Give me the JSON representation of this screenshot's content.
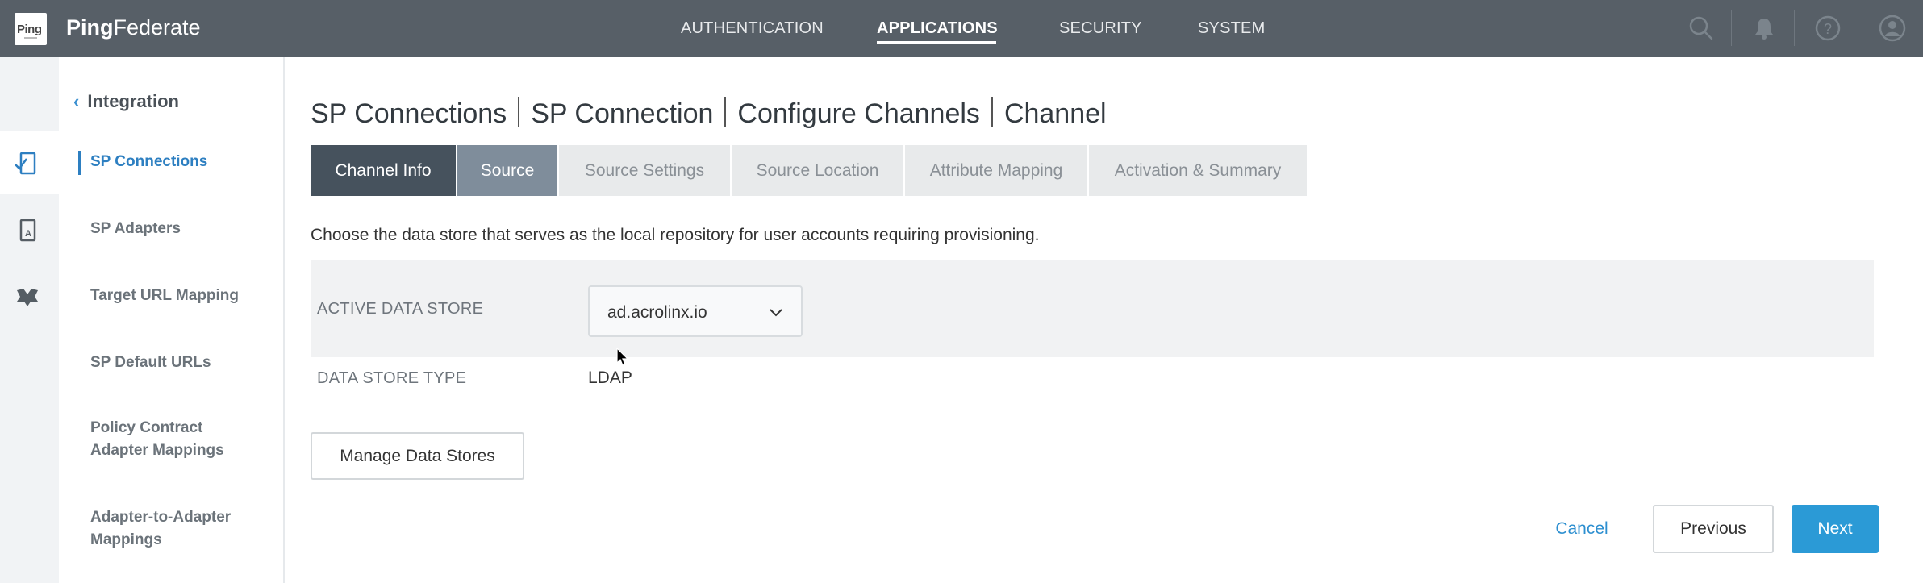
{
  "header": {
    "logo_text": "Ping",
    "brand_bold": "Ping",
    "brand_light": "Federate",
    "nav": [
      {
        "label": "AUTHENTICATION"
      },
      {
        "label": "APPLICATIONS",
        "active": true
      },
      {
        "label": "SECURITY"
      },
      {
        "label": "SYSTEM"
      }
    ],
    "icons": [
      "search-icon",
      "bell-icon",
      "help-icon",
      "user-icon"
    ]
  },
  "rail": {
    "icons": [
      "sp-connection-icon",
      "sp-adapter-icon",
      "federation-icon"
    ]
  },
  "sidebar": {
    "back_label": "Integration",
    "items": [
      {
        "label": "SP Connections",
        "active": true
      },
      {
        "label": "SP Adapters"
      },
      {
        "label": "Target URL Mapping"
      },
      {
        "label": "SP Default URLs"
      },
      {
        "label": "Policy Contract Adapter Mappings"
      },
      {
        "label": "Adapter-to-Adapter Mappings"
      }
    ]
  },
  "breadcrumb": [
    "SP Connections",
    "SP Connection",
    "Configure Channels",
    "Channel"
  ],
  "tabs": [
    {
      "label": "Channel Info",
      "state": "done"
    },
    {
      "label": "Source",
      "state": "current"
    },
    {
      "label": "Source Settings",
      "state": "upcoming"
    },
    {
      "label": "Source Location",
      "state": "upcoming"
    },
    {
      "label": "Attribute Mapping",
      "state": "upcoming"
    },
    {
      "label": "Activation & Summary",
      "state": "upcoming"
    }
  ],
  "content": {
    "description": "Choose the data store that serves as the local repository for user accounts requiring provisioning.",
    "active_data_store_label": "ACTIVE DATA STORE",
    "active_data_store_value": "ad.acrolinx.io",
    "data_store_type_label": "DATA STORE TYPE",
    "data_store_type_value": "LDAP",
    "manage_button": "Manage Data Stores"
  },
  "footer": {
    "cancel": "Cancel",
    "previous": "Previous",
    "next": "Next"
  },
  "colors": {
    "topbar": "#575f67",
    "accent": "#2b9ad6",
    "link": "#2d8fd0",
    "tab_done": "#46525d",
    "tab_current": "#7f8d9b"
  }
}
